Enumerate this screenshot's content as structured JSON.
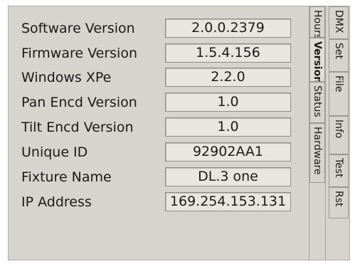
{
  "rows": [
    {
      "label": "Software Version",
      "value": "2.0.0.2379"
    },
    {
      "label": "Firmware Version",
      "value": "1.5.4.156"
    },
    {
      "label": "Windows XPe",
      "value": "2.2.0"
    },
    {
      "label": "Pan Encd Version",
      "value": "1.0"
    },
    {
      "label": "Tilt Encd Version",
      "value": "1.0"
    },
    {
      "label": "Unique ID",
      "value": "92902AA1"
    },
    {
      "label": "Fixture Name",
      "value": "DL.3 one"
    },
    {
      "label": "IP Address",
      "value": "169.254.153.131"
    }
  ],
  "inner_tabs": [
    "Hours",
    "Version",
    "Status",
    "Hardware"
  ],
  "selected_inner_tab": "Version",
  "outer_tabs": [
    "DMX",
    "Set",
    "File",
    "Info",
    "Test",
    "Rst"
  ],
  "colors": {
    "panel_bg": "#d6d4cc",
    "field_bg": "#e8e6de",
    "text": "#1a1a1a"
  }
}
